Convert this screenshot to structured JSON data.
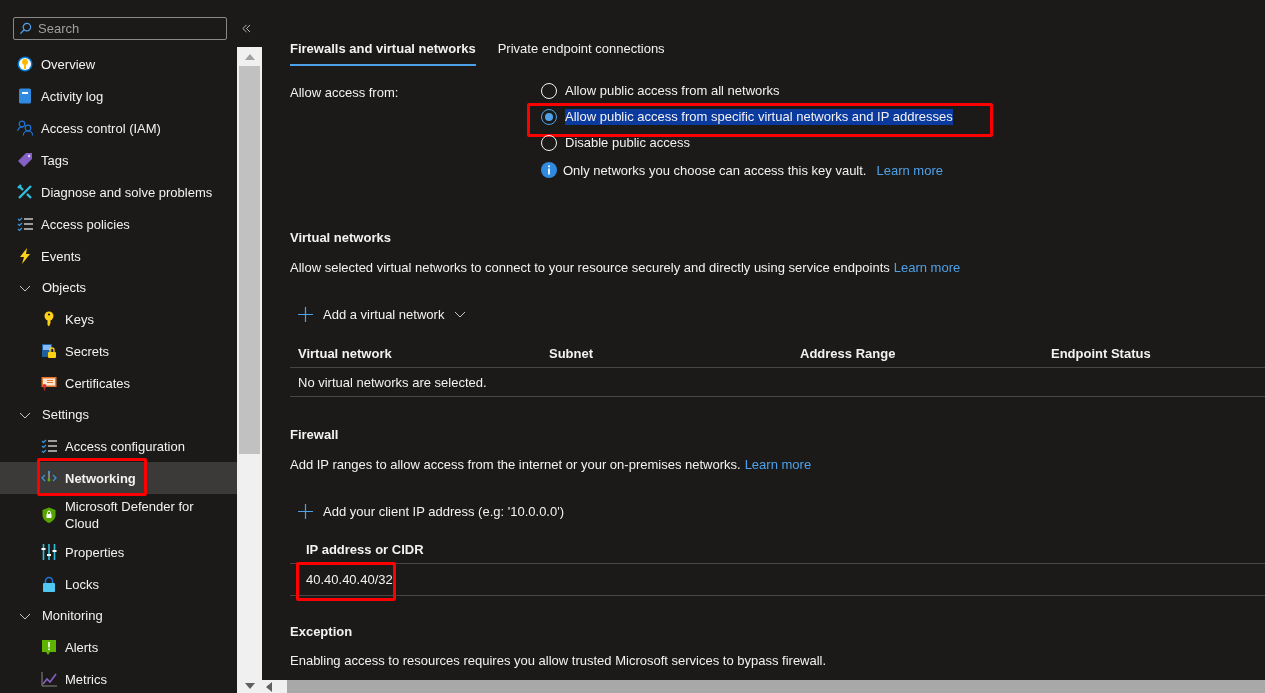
{
  "sidebar": {
    "search": {
      "placeholder": "Search"
    },
    "items": [
      {
        "kind": "link",
        "label": "Overview",
        "selected": false,
        "highlighted": false
      },
      {
        "kind": "link",
        "label": "Activity log",
        "selected": false,
        "highlighted": false
      },
      {
        "kind": "link",
        "label": "Access control (IAM)",
        "selected": false,
        "highlighted": false
      },
      {
        "kind": "link",
        "label": "Tags",
        "selected": false,
        "highlighted": false
      },
      {
        "kind": "link",
        "label": "Diagnose and solve problems",
        "selected": false,
        "highlighted": false
      },
      {
        "kind": "link",
        "label": "Access policies",
        "selected": false,
        "highlighted": false
      },
      {
        "kind": "link",
        "label": "Events",
        "selected": false,
        "highlighted": false
      },
      {
        "kind": "group",
        "label": "Objects",
        "expanded": true,
        "children": [
          {
            "kind": "link",
            "label": "Keys",
            "selected": false,
            "highlighted": false
          },
          {
            "kind": "link",
            "label": "Secrets",
            "selected": false,
            "highlighted": false
          },
          {
            "kind": "link",
            "label": "Certificates",
            "selected": false,
            "highlighted": false
          }
        ]
      },
      {
        "kind": "group",
        "label": "Settings",
        "expanded": true,
        "children": [
          {
            "kind": "link",
            "label": "Access configuration",
            "selected": false,
            "highlighted": false
          },
          {
            "kind": "link",
            "label": "Networking",
            "selected": true,
            "highlighted": true
          },
          {
            "kind": "link",
            "label": "Microsoft Defender for Cloud",
            "selected": false,
            "highlighted": false
          },
          {
            "kind": "link",
            "label": "Properties",
            "selected": false,
            "highlighted": false
          },
          {
            "kind": "link",
            "label": "Locks",
            "selected": false,
            "highlighted": false
          }
        ]
      },
      {
        "kind": "group",
        "label": "Monitoring",
        "expanded": true,
        "children": [
          {
            "kind": "link",
            "label": "Alerts",
            "selected": false,
            "highlighted": false
          },
          {
            "kind": "link",
            "label": "Metrics",
            "selected": false,
            "highlighted": false
          }
        ]
      }
    ]
  },
  "tabs": [
    {
      "label": "Firewalls and virtual networks",
      "selected": true
    },
    {
      "label": "Private endpoint connections",
      "selected": false
    }
  ],
  "access": {
    "label": "Allow access from:",
    "options": [
      {
        "label": "Allow public access from all networks",
        "selected": false,
        "highlighted": false,
        "text_selected": false
      },
      {
        "label": "Allow public access from specific virtual networks and IP addresses",
        "selected": true,
        "highlighted": true,
        "text_selected": true
      },
      {
        "label": "Disable public access",
        "selected": false,
        "highlighted": false,
        "text_selected": false
      }
    ],
    "info": {
      "text": "Only networks you choose can access this key vault.",
      "link": "Learn more"
    }
  },
  "virtual_networks": {
    "title": "Virtual networks",
    "description": "Allow selected virtual networks to connect to your resource securely and directly using service endpoints",
    "link": "Learn more",
    "add_button": "Add a virtual network",
    "columns": [
      "Virtual network",
      "Subnet",
      "Address Range",
      "Endpoint Status"
    ],
    "empty_text": "No virtual networks are selected."
  },
  "firewall": {
    "title": "Firewall",
    "description": "Add IP ranges to allow access from the internet or your on-premises networks.",
    "link": "Learn more",
    "add_button": "Add your client IP address (e.g: '10.0.0.0')",
    "column": "IP address or CIDR",
    "rows": [
      {
        "value": "40.40.40.40/32",
        "highlighted": true
      }
    ]
  },
  "exception": {
    "title": "Exception",
    "description": "Enabling access to resources requires you allow trusted Microsoft services to bypass firewall."
  }
}
